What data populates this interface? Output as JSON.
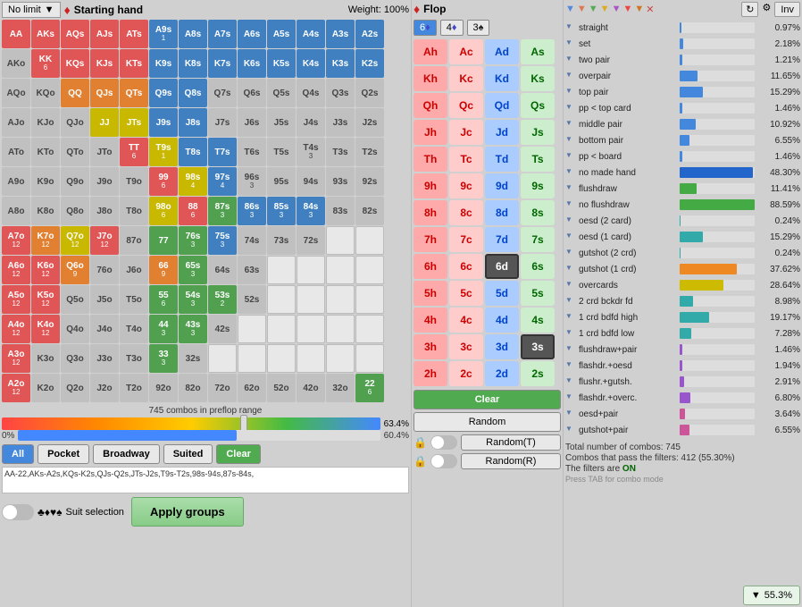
{
  "header": {
    "dropdown": "No limit",
    "starting_hand": "Starting hand",
    "weight_label": "Weight:",
    "weight_value": "100%"
  },
  "hand_grid": {
    "combos_label": "745 combos in preflop range",
    "slider_pct": "63.4%",
    "range_pct": "60.4%",
    "pct_left": "0%"
  },
  "buttons": {
    "all": "All",
    "pocket": "Pocket",
    "broadway": "Broadway",
    "suited": "Suited",
    "clear": "Clear"
  },
  "hand_text": "AA-22,AKs-A2s,KQs-K2s,QJs-Q2s,JTs-J2s,T9s-T2s,98s-94s,87s-84s,",
  "suit_selection": "Suit selection",
  "apply_groups": "Apply groups",
  "flop": {
    "header": "Flop",
    "suit_tabs": [
      "6♦",
      "4♦",
      "3♠"
    ],
    "clear_btn": "Clear",
    "random_btn": "Random",
    "randomT_btn": "Random(T)",
    "randomR_btn": "Random(R)",
    "cards": [
      {
        "label": "Ah",
        "class": "card-pink"
      },
      {
        "label": "Ac",
        "class": "card-lpink"
      },
      {
        "label": "Ad",
        "class": "card-blue-c"
      },
      {
        "label": "As",
        "class": "card-lgreen"
      },
      {
        "label": "Kh",
        "class": "card-pink"
      },
      {
        "label": "Kc",
        "class": "card-lpink"
      },
      {
        "label": "Kd",
        "class": "card-blue-c"
      },
      {
        "label": "Ks",
        "class": "card-lgreen"
      },
      {
        "label": "Qh",
        "class": "card-pink"
      },
      {
        "label": "Qc",
        "class": "card-lpink"
      },
      {
        "label": "Qd",
        "class": "card-blue-c"
      },
      {
        "label": "Qs",
        "class": "card-lgreen"
      },
      {
        "label": "Jh",
        "class": "card-pink"
      },
      {
        "label": "Jc",
        "class": "card-lpink"
      },
      {
        "label": "Jd",
        "class": "card-blue-c"
      },
      {
        "label": "Js",
        "class": "card-lgreen"
      },
      {
        "label": "Th",
        "class": "card-pink"
      },
      {
        "label": "Tc",
        "class": "card-lpink"
      },
      {
        "label": "Td",
        "class": "card-blue-c"
      },
      {
        "label": "Ts",
        "class": "card-lgreen"
      },
      {
        "label": "9h",
        "class": "card-pink"
      },
      {
        "label": "9c",
        "class": "card-lpink"
      },
      {
        "label": "9d",
        "class": "card-blue-c"
      },
      {
        "label": "9s",
        "class": "card-lgreen"
      },
      {
        "label": "8h",
        "class": "card-pink"
      },
      {
        "label": "8c",
        "class": "card-lpink"
      },
      {
        "label": "8d",
        "class": "card-blue-c"
      },
      {
        "label": "8s",
        "class": "card-lgreen"
      },
      {
        "label": "7h",
        "class": "card-pink"
      },
      {
        "label": "7c",
        "class": "card-lpink"
      },
      {
        "label": "7d",
        "class": "card-blue-c"
      },
      {
        "label": "7s",
        "class": "card-lgreen"
      },
      {
        "label": "6h",
        "class": "card-pink"
      },
      {
        "label": "6c",
        "class": "card-lpink"
      },
      {
        "label": "6d",
        "class": "card-selected"
      },
      {
        "label": "6s",
        "class": "card-lgreen"
      },
      {
        "label": "5h",
        "class": "card-pink"
      },
      {
        "label": "5c",
        "class": "card-lpink"
      },
      {
        "label": "5d",
        "class": "card-blue-c"
      },
      {
        "label": "5s",
        "class": "card-lgreen"
      },
      {
        "label": "4h",
        "class": "card-pink"
      },
      {
        "label": "4c",
        "class": "card-lpink"
      },
      {
        "label": "4d",
        "class": "card-blue-c"
      },
      {
        "label": "4s",
        "class": "card-lgreen"
      },
      {
        "label": "3h",
        "class": "card-pink"
      },
      {
        "label": "3c",
        "class": "card-lpink"
      },
      {
        "label": "3d",
        "class": "card-blue-c"
      },
      {
        "label": "3s",
        "class": "card-selected"
      },
      {
        "label": "2h",
        "class": "card-pink"
      },
      {
        "label": "2c",
        "class": "card-lpink"
      },
      {
        "label": "2d",
        "class": "card-blue-c"
      },
      {
        "label": "2s",
        "class": "card-lgreen"
      }
    ]
  },
  "stats": {
    "filter_icons": [
      "▼",
      "▼",
      "▼",
      "▼",
      "▼",
      "▼",
      "▼",
      "✕"
    ],
    "rows": [
      {
        "name": "straight",
        "value": "0.97%",
        "bar_pct": 2,
        "bar_color": "bar-blue"
      },
      {
        "name": "set",
        "value": "2.18%",
        "bar_pct": 5,
        "bar_color": "bar-blue"
      },
      {
        "name": "two pair",
        "value": "1.21%",
        "bar_pct": 3,
        "bar_color": "bar-blue"
      },
      {
        "name": "overpair",
        "value": "11.65%",
        "bar_pct": 24,
        "bar_color": "bar-blue"
      },
      {
        "name": "top pair",
        "value": "15.29%",
        "bar_pct": 31,
        "bar_color": "bar-blue"
      },
      {
        "name": "pp < top card",
        "value": "1.46%",
        "bar_pct": 3,
        "bar_color": "bar-blue"
      },
      {
        "name": "middle pair",
        "value": "10.92%",
        "bar_pct": 22,
        "bar_color": "bar-blue"
      },
      {
        "name": "bottom pair",
        "value": "6.55%",
        "bar_pct": 13,
        "bar_color": "bar-blue"
      },
      {
        "name": "pp < board",
        "value": "1.46%",
        "bar_pct": 3,
        "bar_color": "bar-blue"
      },
      {
        "name": "no made hand",
        "value": "48.30%",
        "bar_pct": 98,
        "bar_color": "bar-blue"
      },
      {
        "name": "flushdraw",
        "value": "11.41%",
        "bar_pct": 23,
        "bar_color": "bar-green"
      },
      {
        "name": "no flushdraw",
        "value": "88.59%",
        "bar_pct": 100,
        "bar_color": "bar-green"
      },
      {
        "name": "oesd (2 card)",
        "value": "0.24%",
        "bar_pct": 1,
        "bar_color": "bar-teal"
      },
      {
        "name": "oesd (1 card)",
        "value": "15.29%",
        "bar_pct": 31,
        "bar_color": "bar-teal"
      },
      {
        "name": "gutshot (2 crd)",
        "value": "0.24%",
        "bar_pct": 1,
        "bar_color": "bar-teal"
      },
      {
        "name": "gutshot (1 crd)",
        "value": "37.62%",
        "bar_pct": 76,
        "bar_color": "bar-orange"
      },
      {
        "name": "overcards",
        "value": "28.64%",
        "bar_pct": 58,
        "bar_color": "bar-yellow"
      },
      {
        "name": "2 crd bckdr fd",
        "value": "8.98%",
        "bar_pct": 18,
        "bar_color": "bar-teal"
      },
      {
        "name": "1 crd bdfd high",
        "value": "19.17%",
        "bar_pct": 39,
        "bar_color": "bar-teal"
      },
      {
        "name": "1 crd bdfd low",
        "value": "7.28%",
        "bar_pct": 15,
        "bar_color": "bar-teal"
      },
      {
        "name": "flushdraw+pair",
        "value": "1.46%",
        "bar_pct": 3,
        "bar_color": "bar-purple"
      },
      {
        "name": "flashdr.+oesd",
        "value": "1.94%",
        "bar_pct": 4,
        "bar_color": "bar-purple"
      },
      {
        "name": "flushr.+gutsh.",
        "value": "2.91%",
        "bar_pct": 6,
        "bar_color": "bar-purple"
      },
      {
        "name": "flashdr.+overc.",
        "value": "6.80%",
        "bar_pct": 14,
        "bar_color": "bar-purple"
      },
      {
        "name": "oesd+pair",
        "value": "3.64%",
        "bar_pct": 7,
        "bar_color": "bar-pink"
      },
      {
        "name": "gutshot+pair",
        "value": "6.55%",
        "bar_pct": 13,
        "bar_color": "bar-pink"
      }
    ],
    "totals": {
      "total_combos": "Total number of combos: 745",
      "combos_pass": "Combos that pass the filters: 412 (55.30%)",
      "filters_status": "The filters are",
      "filters_on": "ON",
      "tab_hint": "Press TAB for combo mode"
    },
    "filter_result": "55.3%"
  },
  "cells": [
    {
      "label": "AA",
      "sub": "",
      "color": "cell-red"
    },
    {
      "label": "AKs",
      "sub": "",
      "color": "cell-red"
    },
    {
      "label": "AQs",
      "sub": "",
      "color": "cell-red"
    },
    {
      "label": "AJs",
      "sub": "",
      "color": "cell-red"
    },
    {
      "label": "ATs",
      "sub": "",
      "color": "cell-red"
    },
    {
      "label": "A9s",
      "sub": "1",
      "color": "cell-blue"
    },
    {
      "label": "A8s",
      "sub": "",
      "color": "cell-blue"
    },
    {
      "label": "A7s",
      "sub": "",
      "color": "cell-blue"
    },
    {
      "label": "A6s",
      "sub": "",
      "color": "cell-blue"
    },
    {
      "label": "A5s",
      "sub": "",
      "color": "cell-blue"
    },
    {
      "label": "A4s",
      "sub": "",
      "color": "cell-blue"
    },
    {
      "label": "A3s",
      "sub": "",
      "color": "cell-blue"
    },
    {
      "label": "A2s",
      "sub": "",
      "color": "cell-blue"
    },
    {
      "label": "AKo",
      "sub": "",
      "color": "cell-lightgray"
    },
    {
      "label": "KK",
      "sub": "6",
      "color": "cell-red"
    },
    {
      "label": "KQs",
      "sub": "",
      "color": "cell-red"
    },
    {
      "label": "KJs",
      "sub": "",
      "color": "cell-red"
    },
    {
      "label": "KTs",
      "sub": "",
      "color": "cell-red"
    },
    {
      "label": "K9s",
      "sub": "",
      "color": "cell-blue"
    },
    {
      "label": "K8s",
      "sub": "",
      "color": "cell-blue"
    },
    {
      "label": "K7s",
      "sub": "",
      "color": "cell-blue"
    },
    {
      "label": "K6s",
      "sub": "",
      "color": "cell-blue"
    },
    {
      "label": "K5s",
      "sub": "",
      "color": "cell-blue"
    },
    {
      "label": "K4s",
      "sub": "",
      "color": "cell-blue"
    },
    {
      "label": "K3s",
      "sub": "",
      "color": "cell-blue"
    },
    {
      "label": "K2s",
      "sub": "",
      "color": "cell-blue"
    },
    {
      "label": "AQo",
      "sub": "",
      "color": "cell-lightgray"
    },
    {
      "label": "KQo",
      "sub": "",
      "color": "cell-lightgray"
    },
    {
      "label": "QQ",
      "sub": "",
      "color": "cell-orange"
    },
    {
      "label": "QJs",
      "sub": "",
      "color": "cell-orange"
    },
    {
      "label": "QTs",
      "sub": "",
      "color": "cell-orange"
    },
    {
      "label": "Q9s",
      "sub": "",
      "color": "cell-blue"
    },
    {
      "label": "Q8s",
      "sub": "",
      "color": "cell-blue"
    },
    {
      "label": "Q7s",
      "sub": "",
      "color": "cell-lightgray"
    },
    {
      "label": "Q6s",
      "sub": "",
      "color": "cell-lightgray"
    },
    {
      "label": "Q5s",
      "sub": "",
      "color": "cell-lightgray"
    },
    {
      "label": "Q4s",
      "sub": "",
      "color": "cell-lightgray"
    },
    {
      "label": "Q3s",
      "sub": "",
      "color": "cell-lightgray"
    },
    {
      "label": "Q2s",
      "sub": "",
      "color": "cell-lightgray"
    },
    {
      "label": "AJo",
      "sub": "",
      "color": "cell-lightgray"
    },
    {
      "label": "KJo",
      "sub": "",
      "color": "cell-lightgray"
    },
    {
      "label": "QJo",
      "sub": "",
      "color": "cell-lightgray"
    },
    {
      "label": "JJ",
      "sub": "",
      "color": "cell-yellow"
    },
    {
      "label": "JTs",
      "sub": "",
      "color": "cell-yellow"
    },
    {
      "label": "J9s",
      "sub": "",
      "color": "cell-blue"
    },
    {
      "label": "J8s",
      "sub": "",
      "color": "cell-blue"
    },
    {
      "label": "J7s",
      "sub": "",
      "color": "cell-lightgray"
    },
    {
      "label": "J6s",
      "sub": "",
      "color": "cell-lightgray"
    },
    {
      "label": "J5s",
      "sub": "",
      "color": "cell-lightgray"
    },
    {
      "label": "J4s",
      "sub": "",
      "color": "cell-lightgray"
    },
    {
      "label": "J3s",
      "sub": "",
      "color": "cell-lightgray"
    },
    {
      "label": "J2s",
      "sub": "",
      "color": "cell-lightgray"
    },
    {
      "label": "ATo",
      "sub": "",
      "color": "cell-lightgray"
    },
    {
      "label": "KTo",
      "sub": "",
      "color": "cell-lightgray"
    },
    {
      "label": "QTo",
      "sub": "",
      "color": "cell-lightgray"
    },
    {
      "label": "JTo",
      "sub": "",
      "color": "cell-lightgray"
    },
    {
      "label": "TT",
      "sub": "6",
      "color": "cell-red"
    },
    {
      "label": "T9s",
      "sub": "1",
      "color": "cell-yellow"
    },
    {
      "label": "T8s",
      "sub": "",
      "color": "cell-blue"
    },
    {
      "label": "T7s",
      "sub": "",
      "color": "cell-blue"
    },
    {
      "label": "T6s",
      "sub": "",
      "color": "cell-lightgray"
    },
    {
      "label": "T5s",
      "sub": "",
      "color": "cell-lightgray"
    },
    {
      "label": "T4s",
      "sub": "3",
      "color": "cell-lightgray"
    },
    {
      "label": "T3s",
      "sub": "",
      "color": "cell-lightgray"
    },
    {
      "label": "T2s",
      "sub": "",
      "color": "cell-lightgray"
    },
    {
      "label": "A9o",
      "sub": "",
      "color": "cell-lightgray"
    },
    {
      "label": "K9o",
      "sub": "",
      "color": "cell-lightgray"
    },
    {
      "label": "Q9o",
      "sub": "",
      "color": "cell-lightgray"
    },
    {
      "label": "J9o",
      "sub": "",
      "color": "cell-lightgray"
    },
    {
      "label": "T9o",
      "sub": "",
      "color": "cell-lightgray"
    },
    {
      "label": "99",
      "sub": "6",
      "color": "cell-red"
    },
    {
      "label": "98s",
      "sub": "4",
      "color": "cell-yellow"
    },
    {
      "label": "97s",
      "sub": "4",
      "color": "cell-blue"
    },
    {
      "label": "96s",
      "sub": "3",
      "color": "cell-lightgray"
    },
    {
      "label": "95s",
      "sub": "",
      "color": "cell-lightgray"
    },
    {
      "label": "94s",
      "sub": "",
      "color": "cell-lightgray"
    },
    {
      "label": "93s",
      "sub": "",
      "color": "cell-lightgray"
    },
    {
      "label": "92s",
      "sub": "",
      "color": "cell-lightgray"
    },
    {
      "label": "A8o",
      "sub": "",
      "color": "cell-lightgray"
    },
    {
      "label": "K8o",
      "sub": "",
      "color": "cell-lightgray"
    },
    {
      "label": "Q8o",
      "sub": "",
      "color": "cell-lightgray"
    },
    {
      "label": "J8o",
      "sub": "",
      "color": "cell-lightgray"
    },
    {
      "label": "T8o",
      "sub": "",
      "color": "cell-lightgray"
    },
    {
      "label": "98o",
      "sub": "6",
      "color": "cell-yellow"
    },
    {
      "label": "88",
      "sub": "6",
      "color": "cell-red"
    },
    {
      "label": "87s",
      "sub": "3",
      "color": "cell-green"
    },
    {
      "label": "86s",
      "sub": "3",
      "color": "cell-blue"
    },
    {
      "label": "85s",
      "sub": "3",
      "color": "cell-blue"
    },
    {
      "label": "84s",
      "sub": "3",
      "color": "cell-blue"
    },
    {
      "label": "83s",
      "sub": "",
      "color": "cell-lightgray"
    },
    {
      "label": "82s",
      "sub": "",
      "color": "cell-lightgray"
    },
    {
      "label": "A7o",
      "sub": "12",
      "color": "cell-red"
    },
    {
      "label": "K7o",
      "sub": "12",
      "color": "cell-orange"
    },
    {
      "label": "Q7o",
      "sub": "12",
      "color": "cell-yellow"
    },
    {
      "label": "J7o",
      "sub": "12",
      "color": "cell-red"
    },
    {
      "label": "87o",
      "sub": "",
      "color": "cell-lightgray"
    },
    {
      "label": "77",
      "sub": "",
      "color": "cell-green"
    },
    {
      "label": "76s",
      "sub": "3",
      "color": "cell-green"
    },
    {
      "label": "75s",
      "sub": "3",
      "color": "cell-blue"
    },
    {
      "label": "74s",
      "sub": "",
      "color": "cell-lightgray"
    },
    {
      "label": "73s",
      "sub": "",
      "color": "cell-lightgray"
    },
    {
      "label": "72s",
      "sub": "",
      "color": "cell-lightgray"
    },
    {
      "label": "A6o",
      "sub": "12",
      "color": "cell-red"
    },
    {
      "label": "K6o",
      "sub": "12",
      "color": "cell-red"
    },
    {
      "label": "Q6o",
      "sub": "9",
      "color": "cell-orange"
    },
    {
      "label": "76o",
      "sub": "",
      "color": "cell-lightgray"
    },
    {
      "label": "66",
      "sub": "9",
      "color": "cell-orange"
    },
    {
      "label": "65s",
      "sub": "3",
      "color": "cell-green"
    },
    {
      "label": "64s",
      "sub": "",
      "color": "cell-lightgray"
    },
    {
      "label": "63s",
      "sub": "",
      "color": "cell-lightgray"
    },
    {
      "label": "A5o",
      "sub": "12",
      "color": "cell-red"
    },
    {
      "label": "K5o",
      "sub": "12",
      "color": "cell-red"
    },
    {
      "label": "55",
      "sub": "6",
      "color": "cell-green"
    },
    {
      "label": "54s",
      "sub": "3",
      "color": "cell-green"
    },
    {
      "label": "53s",
      "sub": "2",
      "color": "cell-green"
    },
    {
      "label": "52s",
      "sub": "",
      "color": "cell-lightgray"
    },
    {
      "label": "A4o",
      "sub": "12",
      "color": "cell-red"
    },
    {
      "label": "K4o",
      "sub": "12",
      "color": "cell-red"
    },
    {
      "label": "44",
      "sub": "3",
      "color": "cell-green"
    },
    {
      "label": "43s",
      "sub": "3",
      "color": "cell-green"
    },
    {
      "label": "42s",
      "sub": "",
      "color": "cell-lightgray"
    },
    {
      "label": "A3o",
      "sub": "12",
      "color": "cell-red"
    },
    {
      "label": "33",
      "sub": "3",
      "color": "cell-green"
    },
    {
      "label": "32s",
      "sub": "",
      "color": "cell-lightgray"
    },
    {
      "label": "A2o",
      "sub": "12",
      "color": "cell-red"
    },
    {
      "label": "22",
      "sub": "6",
      "color": "cell-green"
    }
  ]
}
